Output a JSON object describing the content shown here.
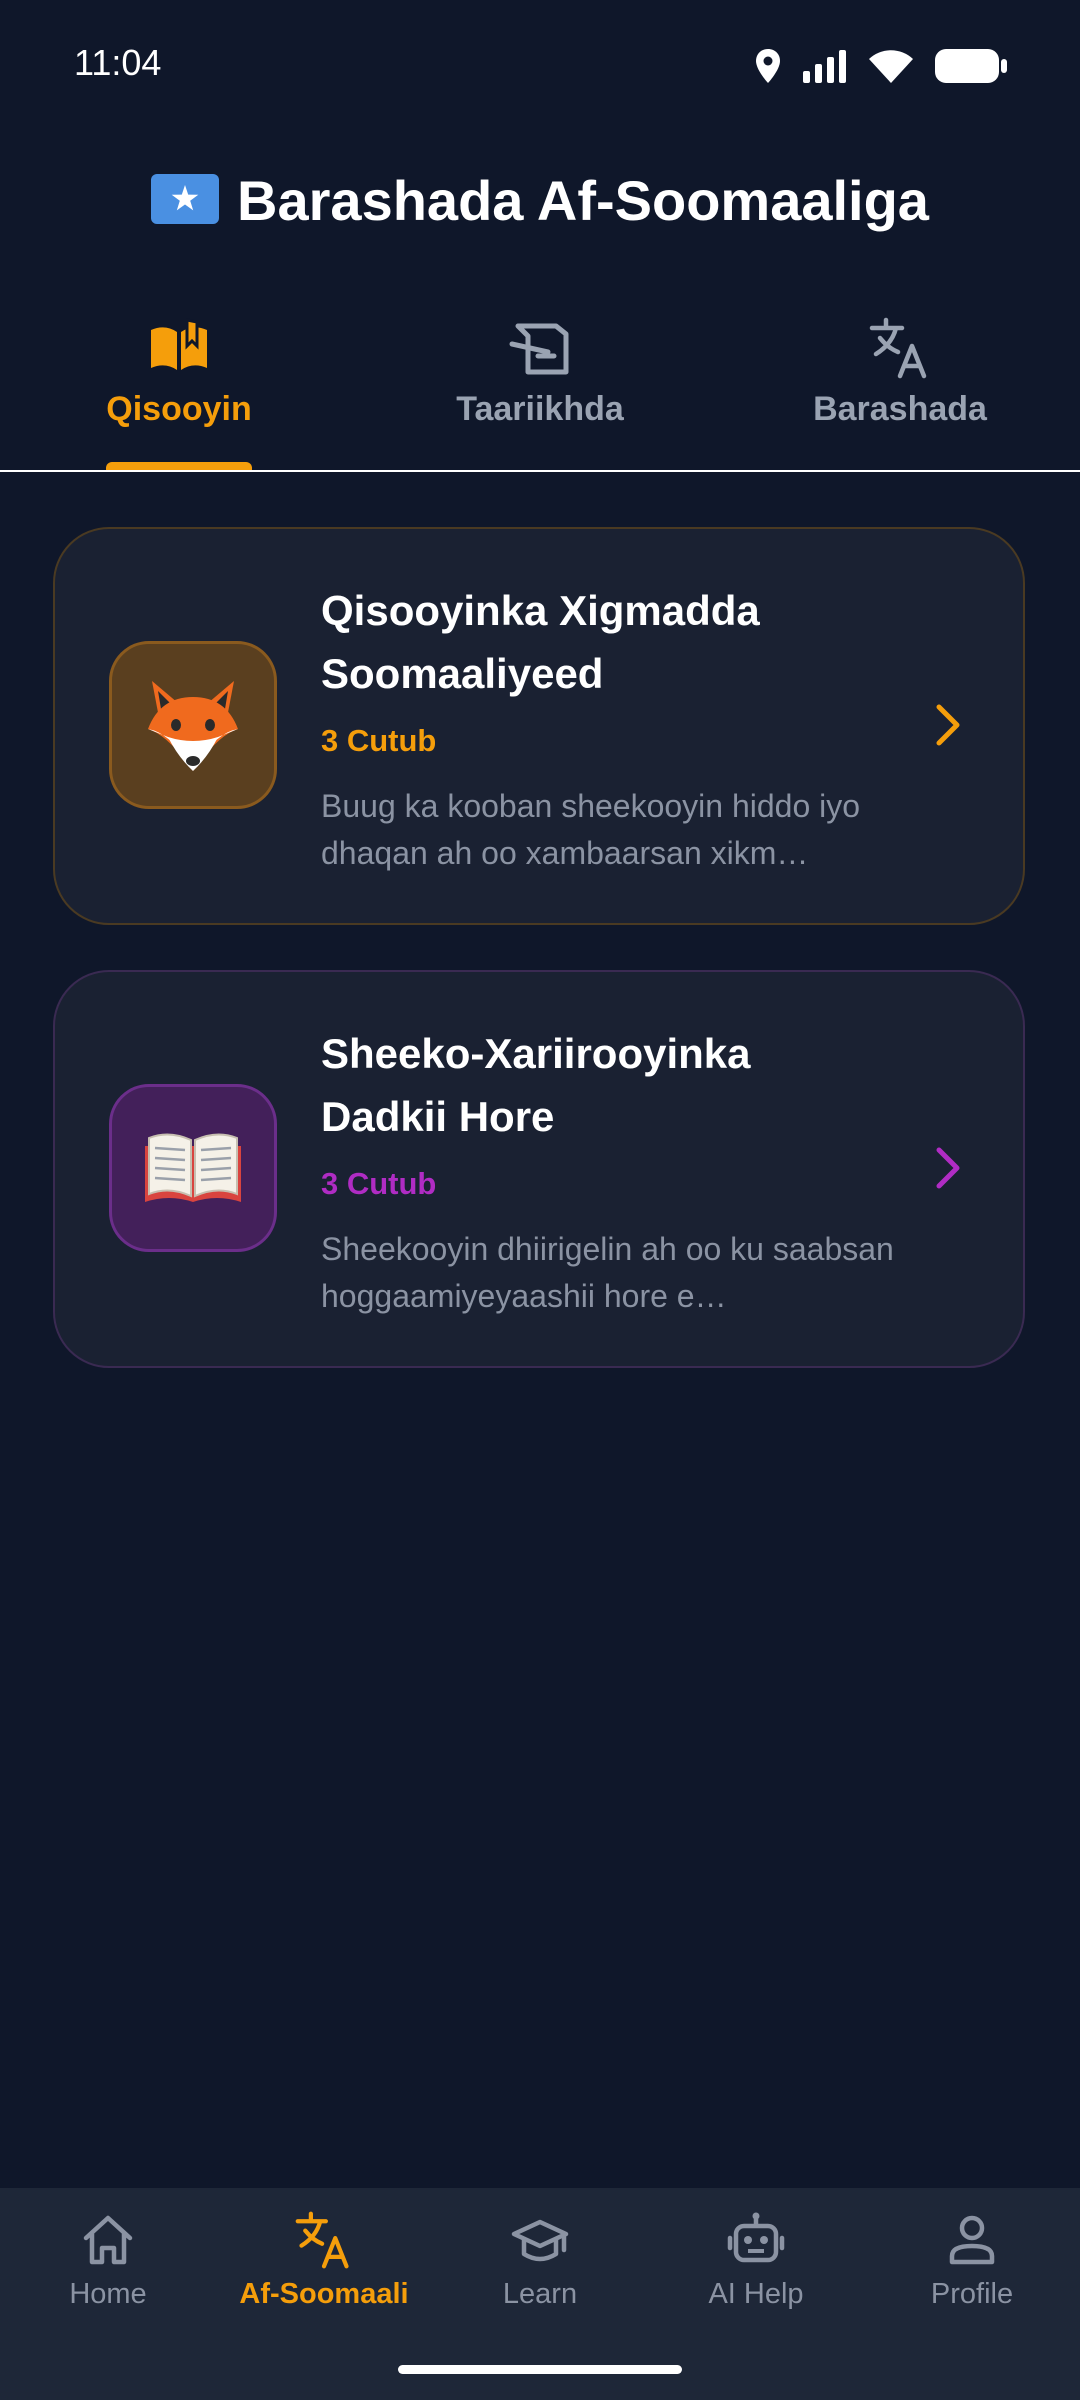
{
  "status_bar": {
    "time": "11:04"
  },
  "header": {
    "title": "Barashada Af-Soomaaliga"
  },
  "tabs": [
    {
      "label": "Qisooyin",
      "icon": "open-book-icon",
      "active": true
    },
    {
      "label": "Taariikhda",
      "icon": "history-scroll-icon",
      "active": false
    },
    {
      "label": "Barashada",
      "icon": "translate-icon",
      "active": false
    }
  ],
  "stories": [
    {
      "icon": "fox-emoji",
      "title": "Qisooyinka Xigmadda Soomaaliyeed",
      "count": "3 Cutub",
      "description": "Buug ka kooban sheekooyin hiddo iyo dhaqan ah oo xambaarsan xikm…",
      "accent_color": "#f59e0b"
    },
    {
      "icon": "open-book-emoji",
      "title": "Sheeko-Xariirooyinka Dadkii Hore",
      "count": "3 Cutub",
      "description": "Sheekooyin dhiirigelin ah oo ku saabsan hoggaamiyeyaashii hore e…",
      "accent_color": "#b02cc4"
    }
  ],
  "bottom_nav": [
    {
      "label": "Home",
      "icon": "home-icon",
      "active": false
    },
    {
      "label": "Af-Soomaali",
      "icon": "translate-icon",
      "active": true
    },
    {
      "label": "Learn",
      "icon": "graduation-cap-icon",
      "active": false
    },
    {
      "label": "AI Help",
      "icon": "robot-icon",
      "active": false
    },
    {
      "label": "Profile",
      "icon": "person-icon",
      "active": false
    }
  ],
  "colors": {
    "background": "#0f172a",
    "accent": "#f59e0b",
    "inactive": "#9aa3b2",
    "card": "#1a2132",
    "nav_background": "#1e2738"
  }
}
